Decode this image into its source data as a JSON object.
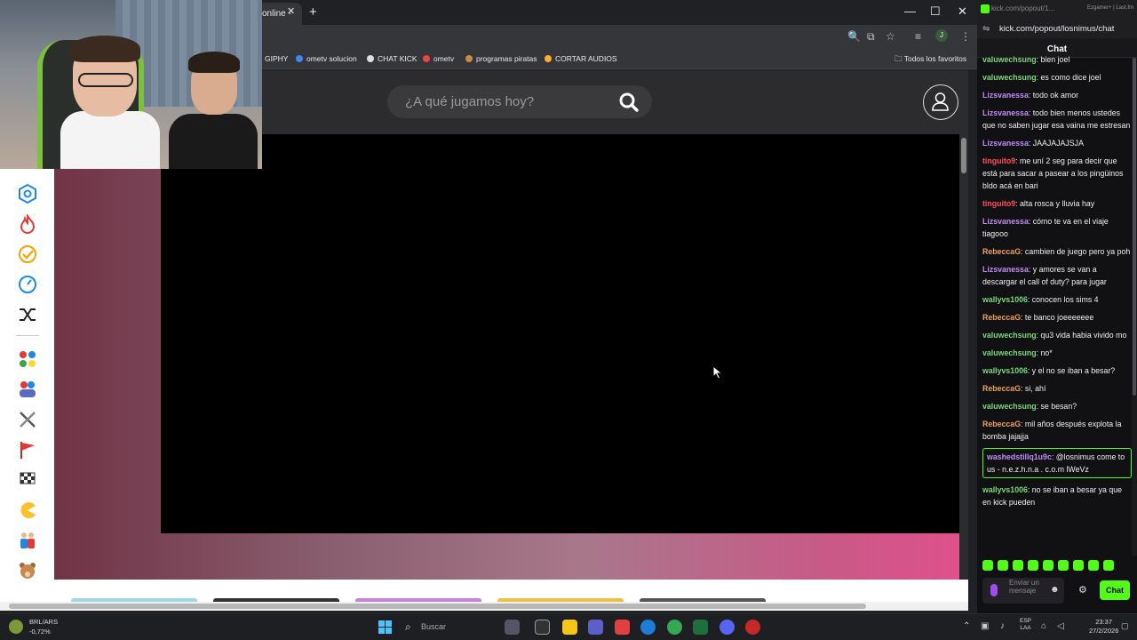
{
  "browser": {
    "tab_title": "online -",
    "tab_close": "✕",
    "new_tab": "+",
    "window": {
      "minimize": "—",
      "maximize": "☐",
      "close": "✕"
    },
    "profile_initial": "J",
    "bookmarks": [
      {
        "label": "GIPHY",
        "color": "#a2f"
      },
      {
        "label": "ometv solucion",
        "color": "#4285f4"
      },
      {
        "label": "CHAT KICK",
        "color": "#ddd"
      },
      {
        "label": "ometv",
        "color": "#e44"
      },
      {
        "label": "programas piratas",
        "color": "#c84"
      },
      {
        "label": "CORTAR AUDIOS",
        "color": "#fa3"
      }
    ],
    "favorites_folder": "Todos los favoritos"
  },
  "site": {
    "search_placeholder": "¿A qué jugamos hoy?",
    "colors": {
      "header": "#2c2c2e",
      "sidebar": "#ffffff"
    }
  },
  "sidebar_icons": [
    "hexagon-icon",
    "flame-icon",
    "check-circle-icon",
    "compass-icon",
    "shuffle-icon",
    "dots-icon",
    "people-icon",
    "swords-icon",
    "flag-icon",
    "checkered-flag-icon",
    "pacman-icon",
    "puzzle-people-icon",
    "bear-icon"
  ],
  "chat": {
    "window_title": "kick.com/popout/1...",
    "titlebar_right": "Ezgamer+ | Last.fm",
    "url": "kick.com/popout/losnimus/chat",
    "header": "Chat",
    "messages": [
      {
        "user": "valuwechsung",
        "color": "#7dd87d",
        "text": "bien joel"
      },
      {
        "user": "valuwechsung",
        "color": "#7dd87d",
        "text": "es como dice joel"
      },
      {
        "user": "Lizsvanessa",
        "color": "#c08df7",
        "text": "todo ok amor"
      },
      {
        "user": "Lizsvanessa",
        "color": "#c08df7",
        "text": "todo bien menos ustedes que no saben jugar esa vaina me estresan"
      },
      {
        "user": "Lizsvanessa",
        "color": "#c08df7",
        "text": "JAAJAJAJSJA"
      },
      {
        "user": "tinguito9",
        "color": "#ff4b5c",
        "text": "me uní 2 seg para decir que está para sacar a pasear a los pingüinos bldo acá en bari"
      },
      {
        "user": "tinguito9",
        "color": "#ff4b5c",
        "text": "alta rosca y lluvia hay"
      },
      {
        "user": "Lizsvanessa",
        "color": "#c08df7",
        "text": "cómo te va en el viaje tiagooo"
      },
      {
        "user": "RebeccaG",
        "color": "#f0a05a",
        "text": "cambien de juego pero ya poh"
      },
      {
        "user": "Lizsvanessa",
        "color": "#c08df7",
        "text": "y amores se van a descargar el call of duty? para jugar"
      },
      {
        "user": "wallyvs1006",
        "color": "#7dd87d",
        "text": "conocen los sims 4"
      },
      {
        "user": "RebeccaG",
        "color": "#f0a05a",
        "text": "te banco joeeeeeee"
      },
      {
        "user": "valuwechsung",
        "color": "#7dd87d",
        "text": "qu3 vida habia vivido mo"
      },
      {
        "user": "valuwechsung",
        "color": "#7dd87d",
        "text": "no*"
      },
      {
        "user": "wallyvs1006",
        "color": "#7dd87d",
        "text": "y el no se iban a besar?"
      },
      {
        "user": "RebeccaG",
        "color": "#f0a05a",
        "text": "si, ahí"
      },
      {
        "user": "valuwechsung",
        "color": "#7dd87d",
        "text": "se besan?"
      },
      {
        "user": "RebeccaG",
        "color": "#f0a05a",
        "text": "mil años después explota la bomba jajajja"
      },
      {
        "user": "washedstillq1u9c",
        "color": "#c08df7",
        "text": "@losnimus come to us - n.e.z.h.n.a . c.o.m lWeVz",
        "highlight": true
      },
      {
        "user": "wallyvs1006",
        "color": "#7dd87d",
        "text": "no se iban a besar ya que en kick pueden"
      }
    ],
    "input_placeholder": "Enviar un mensaje",
    "send_label": "Chat",
    "accent": "#53fc18"
  },
  "taskbar": {
    "ticker_name": "BRL/ARS",
    "ticker_value": "-0,72%",
    "search_label": "Buscar",
    "lang_line1": "ESP",
    "lang_line2": "LAA",
    "time": "23:37",
    "date": "27/2/2026"
  }
}
